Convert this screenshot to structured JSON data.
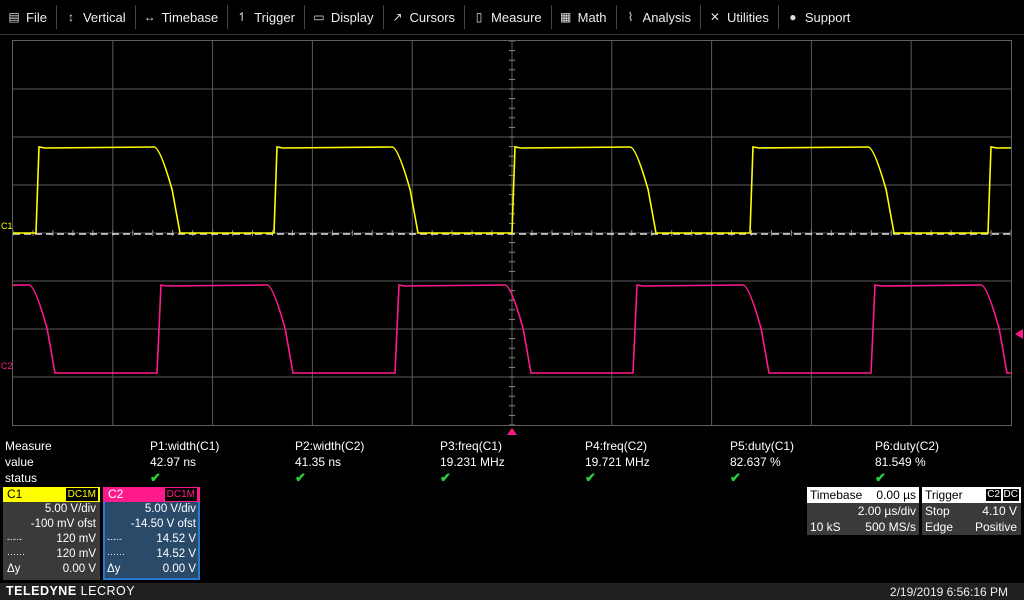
{
  "menu": [
    {
      "label": "File",
      "icon": "folder-icon",
      "glyph": "▤"
    },
    {
      "label": "Vertical",
      "icon": "vertical-arrows-icon",
      "glyph": "↕"
    },
    {
      "label": "Timebase",
      "icon": "horizontal-arrows-icon",
      "glyph": "↔"
    },
    {
      "label": "Trigger",
      "icon": "trigger-edge-icon",
      "glyph": "↿"
    },
    {
      "label": "Display",
      "icon": "display-icon",
      "glyph": "▭"
    },
    {
      "label": "Cursors",
      "icon": "cursor-icon",
      "glyph": "↗"
    },
    {
      "label": "Measure",
      "icon": "measure-icon",
      "glyph": "▯"
    },
    {
      "label": "Math",
      "icon": "calculator-icon",
      "glyph": "▦"
    },
    {
      "label": "Analysis",
      "icon": "analysis-chart-icon",
      "glyph": "⌇"
    },
    {
      "label": "Utilities",
      "icon": "tools-icon",
      "glyph": "✕"
    },
    {
      "label": "Support",
      "icon": "info-icon",
      "glyph": "●"
    }
  ],
  "colors": {
    "ch1": "#ffff00",
    "ch2": "#ff1a8c",
    "grid": "#5a5a5a",
    "check": "#2ecc40",
    "panel": "#3a3a3a"
  },
  "grid_labels": {
    "c1": "C1",
    "c2": "C2"
  },
  "measure": {
    "row_labels": {
      "header": "Measure",
      "value": "value",
      "status": "status"
    },
    "columns": [
      {
        "name": "P1:width(C1)",
        "value": "42.97 ns",
        "status": "ok"
      },
      {
        "name": "P2:width(C2)",
        "value": "41.35 ns",
        "status": "ok"
      },
      {
        "name": "P3:freq(C1)",
        "value": "19.231 MHz",
        "status": "ok"
      },
      {
        "name": "P4:freq(C2)",
        "value": "19.721 MHz",
        "status": "ok"
      },
      {
        "name": "P5:duty(C1)",
        "value": "82.637 %",
        "status": "ok"
      },
      {
        "name": "P6:duty(C2)",
        "value": "81.549 %",
        "status": "ok"
      }
    ],
    "check_glyph": "✔"
  },
  "channels": [
    {
      "name": "C1",
      "coupling": "DC1M",
      "vdiv": "5.00 V/div",
      "offset": "-100 mV ofst",
      "cur1": "120 mV",
      "cur2": "120 mV",
      "dy_label": "Δy",
      "dy": "0.00 V"
    },
    {
      "name": "C2",
      "coupling": "DC1M",
      "vdiv": "5.00 V/div",
      "offset": "-14.50 V ofst",
      "cur1": "14.52 V",
      "cur2": "14.52 V",
      "dy_label": "Δy",
      "dy": "0.00 V"
    }
  ],
  "cursor_glyphs": {
    "c1": "-·-·-",
    "c2": "······"
  },
  "timebase": {
    "label": "Timebase",
    "delay": "0.00 µs",
    "tdiv": "2.00 µs/div",
    "samples": "10 kS",
    "rate": "500 MS/s"
  },
  "trigger": {
    "label": "Trigger",
    "source": "C2",
    "coupling": "DC",
    "mode": "Stop",
    "level": "4.10 V",
    "type": "Edge",
    "slope": "Positive"
  },
  "footer": {
    "brand": "TELEDYNE",
    "brand2": " LECROY",
    "datetime": "2/19/2019 6:56:16 PM"
  }
}
